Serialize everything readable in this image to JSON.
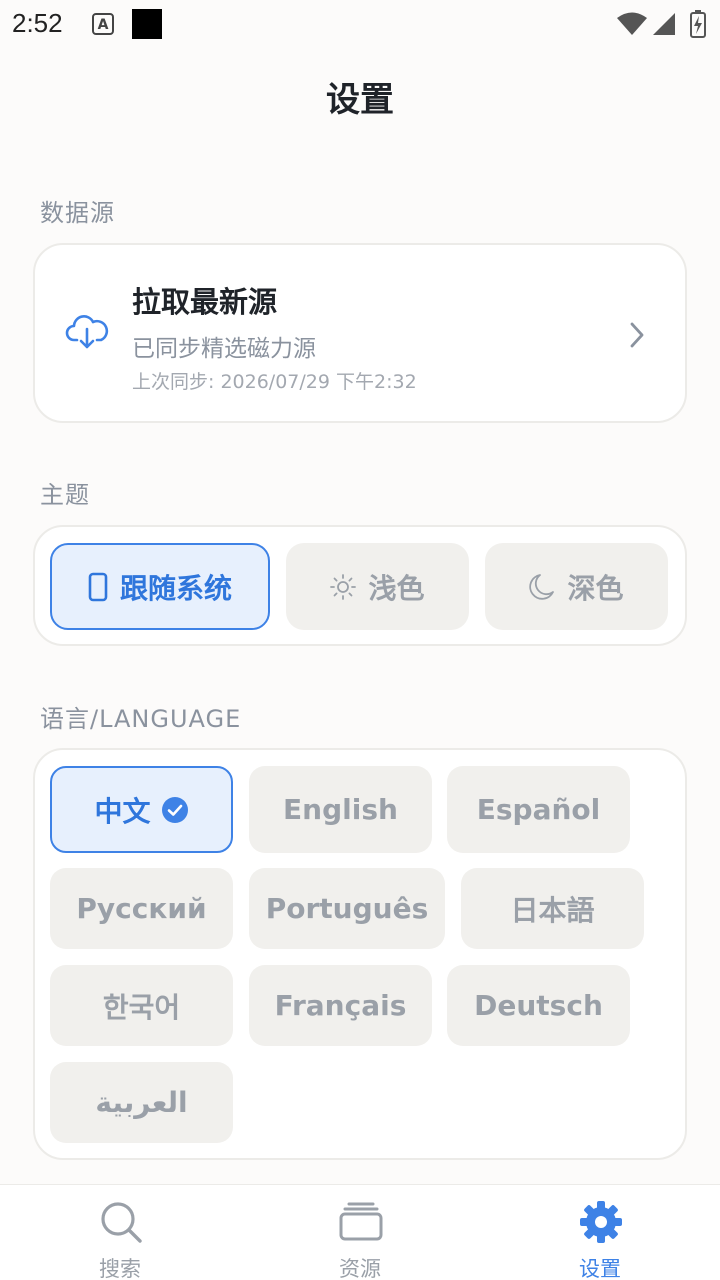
{
  "status_bar": {
    "time": "2:52",
    "icons": [
      "a-notification-icon",
      "square-notification-icon",
      "wifi-icon",
      "signal-icon",
      "battery-icon"
    ]
  },
  "page": {
    "title": "设置"
  },
  "data_source": {
    "section_label": "数据源",
    "title": "拉取最新源",
    "subtitle": "已同步精选磁力源",
    "last_sync": "上次同步: 2026/07/29 下午2:32",
    "icon": "cloud-download-icon"
  },
  "theme": {
    "section_label": "主题",
    "options": [
      {
        "label": "跟随系统",
        "icon": "phone-icon",
        "selected": true
      },
      {
        "label": "浅色",
        "icon": "sun-icon",
        "selected": false
      },
      {
        "label": "深色",
        "icon": "moon-icon",
        "selected": false
      }
    ]
  },
  "language": {
    "section_label": "语言/LANGUAGE",
    "options": [
      {
        "label": "中文",
        "selected": true
      },
      {
        "label": "English",
        "selected": false
      },
      {
        "label": "Español",
        "selected": false
      },
      {
        "label": "Русский",
        "selected": false
      },
      {
        "label": "Português",
        "selected": false
      },
      {
        "label": "日本語",
        "selected": false
      },
      {
        "label": "한국어",
        "selected": false
      },
      {
        "label": "Français",
        "selected": false
      },
      {
        "label": "Deutsch",
        "selected": false
      },
      {
        "label": "العربية",
        "selected": false
      }
    ]
  },
  "bottom_nav": {
    "items": [
      {
        "label": "搜索",
        "icon": "search-icon",
        "active": false
      },
      {
        "label": "资源",
        "icon": "layers-icon",
        "active": false
      },
      {
        "label": "设置",
        "icon": "gear-icon",
        "active": true
      }
    ]
  },
  "colors": {
    "accent": "#3e82e6",
    "background": "#fcfbfa",
    "card": "#ffffff",
    "chip": "#f1f0ed",
    "muted_text": "#9aa0a8"
  }
}
